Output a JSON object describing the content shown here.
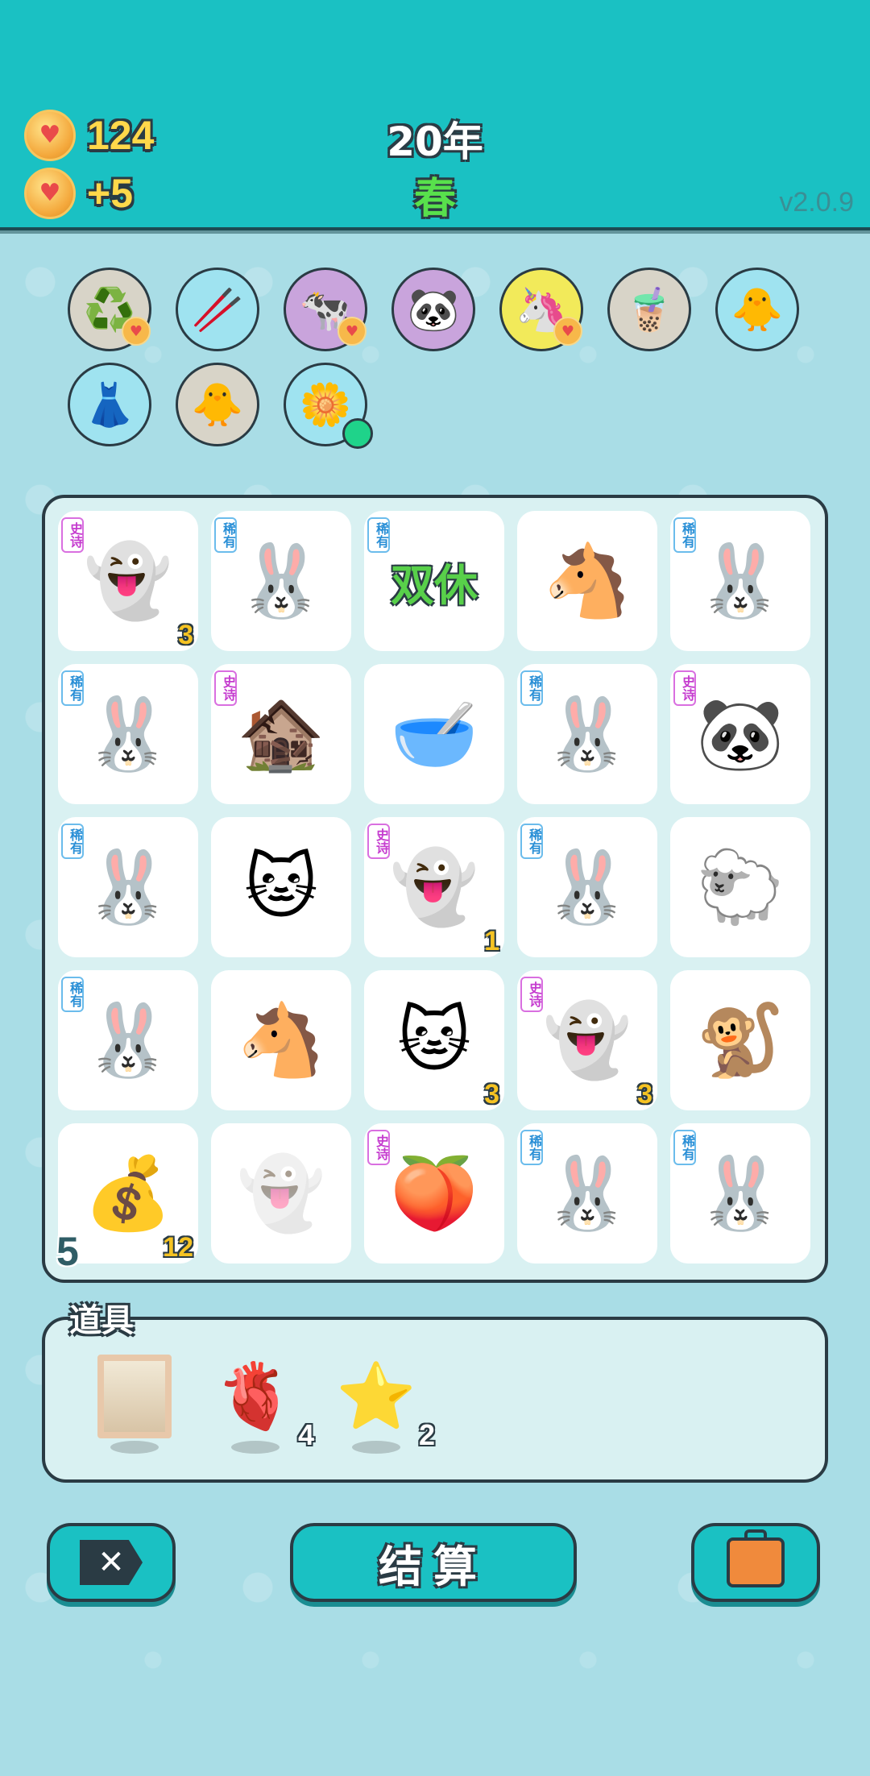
{
  "header": {
    "coins": "124",
    "income": "+5",
    "year": "20年",
    "season": "春",
    "version": "v2.0.9",
    "coin_icon": "heart-coin-icon"
  },
  "buffs": [
    {
      "name": "refresh",
      "icon": "♻️",
      "bg": "#d8d4c8",
      "badge": "heart"
    },
    {
      "name": "chopsticks",
      "icon": "🥢",
      "bg": "#9fe3f0",
      "badge": ""
    },
    {
      "name": "cow-pair",
      "icon": "🐄",
      "bg": "#c9a4dc",
      "badge": "heart"
    },
    {
      "name": "panda",
      "icon": "🐼",
      "bg": "#c9a4dc",
      "badge": ""
    },
    {
      "name": "unicorn",
      "icon": "🦄",
      "bg": "#f2ea5a",
      "badge": "heart"
    },
    {
      "name": "bubble-tea",
      "icon": "🧋",
      "bg": "#d8d4c8",
      "badge": ""
    },
    {
      "name": "chick-egg",
      "icon": "🐥",
      "bg": "#9fe3f0",
      "badge": ""
    },
    {
      "name": "skirt",
      "icon": "👗",
      "bg": "#9fe3f0",
      "badge": ""
    },
    {
      "name": "chick-egg-2",
      "icon": "🐥",
      "bg": "#d8d4c8",
      "badge": ""
    },
    {
      "name": "flower-pot",
      "icon": "🌼",
      "bg": "#9fe3f0",
      "badge": "dot"
    }
  ],
  "rarity_labels": {
    "epic": "史诗",
    "rare": "稀有"
  },
  "board": [
    {
      "name": "ghost",
      "sym": "👻",
      "tag": "epic",
      "count": "3"
    },
    {
      "name": "rabbit",
      "sym": "🐰",
      "tag": "rare",
      "count": ""
    },
    {
      "name": "double-rest",
      "sym": "",
      "word": "双休",
      "tag": "rare",
      "count": ""
    },
    {
      "name": "cow",
      "sym": "🐴",
      "tag": "",
      "count": ""
    },
    {
      "name": "rabbit",
      "sym": "🐰",
      "tag": "rare",
      "count": ""
    },
    {
      "name": "rabbit",
      "sym": "🐰",
      "tag": "rare",
      "count": ""
    },
    {
      "name": "haunted-house",
      "sym": "🏚️",
      "tag": "epic",
      "count": ""
    },
    {
      "name": "bowl",
      "sym": "🥣",
      "tag": "",
      "count": ""
    },
    {
      "name": "rabbit",
      "sym": "🐰",
      "tag": "rare",
      "count": ""
    },
    {
      "name": "panda",
      "sym": "🐼",
      "tag": "epic",
      "count": ""
    },
    {
      "name": "rabbit",
      "sym": "🐰",
      "tag": "rare",
      "count": ""
    },
    {
      "name": "cat",
      "sym": "🐱",
      "tag": "",
      "count": ""
    },
    {
      "name": "ghost",
      "sym": "👻",
      "tag": "epic",
      "count": "1"
    },
    {
      "name": "rabbit",
      "sym": "🐰",
      "tag": "rare",
      "count": ""
    },
    {
      "name": "sheep",
      "sym": "🐑",
      "tag": "",
      "count": ""
    },
    {
      "name": "rabbit",
      "sym": "🐰",
      "tag": "rare",
      "count": ""
    },
    {
      "name": "cow",
      "sym": "🐴",
      "tag": "",
      "count": ""
    },
    {
      "name": "cat",
      "sym": "🐱",
      "tag": "",
      "count": "3"
    },
    {
      "name": "ghost",
      "sym": "👻",
      "tag": "epic",
      "count": "3"
    },
    {
      "name": "monkey",
      "sym": "🐒",
      "tag": "",
      "count": ""
    },
    {
      "name": "coin-safe",
      "sym": "💰",
      "tag": "",
      "count": "12",
      "left": "5"
    },
    {
      "name": "ghost-faded",
      "sym": "👻",
      "tag": "",
      "count": ""
    },
    {
      "name": "peach",
      "sym": "🍑",
      "tag": "epic",
      "count": ""
    },
    {
      "name": "rabbit",
      "sym": "🐰",
      "tag": "rare",
      "count": ""
    },
    {
      "name": "rabbit",
      "sym": "🐰",
      "tag": "rare",
      "count": ""
    }
  ],
  "items": {
    "title": "道具",
    "list": [
      {
        "name": "blank-frame",
        "icon": "frame",
        "count": ""
      },
      {
        "name": "liver",
        "icon": "🫀",
        "count": "4"
      },
      {
        "name": "star",
        "icon": "⭐",
        "count": "2"
      }
    ]
  },
  "buttons": {
    "settle": "结算",
    "delete_icon": "delete-tag-icon",
    "bag_icon": "briefcase-icon"
  }
}
